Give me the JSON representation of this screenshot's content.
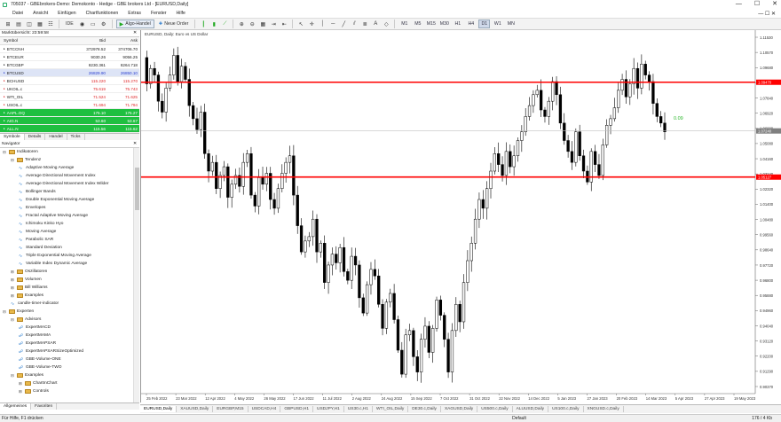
{
  "window": {
    "title": "705037 - GBEbrokers-Demo: Demokonto - Hedge - GBE brokers Ltd - [EURUSD,Daily]"
  },
  "menu": [
    "Datei",
    "Ansicht",
    "Einfügen",
    "Chartfunktionen",
    "Extras",
    "Fenster",
    "Hilfe"
  ],
  "toolbar": {
    "algo": "Algo-Handel",
    "new_order": "Neue Order",
    "ide": "IDE",
    "timeframes": [
      "M1",
      "M5",
      "M15",
      "M30",
      "H1",
      "H4",
      "D1",
      "W1",
      "MN"
    ],
    "active_tf": "D1"
  },
  "market_watch": {
    "title": "Marktübersicht: 23:59:58",
    "headers": [
      "Symbol",
      "Bid",
      "Ask"
    ],
    "rows": [
      {
        "symbol": "BTCCNH",
        "bid": "372978.52",
        "ask": "374706.70",
        "bg": "#ffffff",
        "fg": "#222222",
        "bidc": "#222222",
        "askc": "#222222"
      },
      {
        "symbol": "BTCEUR",
        "bid": "9030.26",
        "ask": "9056.25",
        "bg": "#ffffff",
        "fg": "#222222",
        "bidc": "#222222",
        "askc": "#222222"
      },
      {
        "symbol": "BTCGBP",
        "bid": "8230.361",
        "ask": "8264.718",
        "bg": "#ffffff",
        "fg": "#222222",
        "bidc": "#222222",
        "askc": "#222222"
      },
      {
        "symbol": "BTCUSD",
        "bid": "26829.90",
        "ask": "26850.10",
        "bg": "#dde4f6",
        "fg": "#222222",
        "bidc": "#2a3fd0",
        "askc": "#2a3fd0"
      },
      {
        "symbol": "BCHUSD",
        "bid": "115.220",
        "ask": "115.270",
        "bg": "#ffffff",
        "fg": "#222222",
        "bidc": "#e0282a",
        "askc": "#e0282a"
      },
      {
        "symbol": "UKOIL.c",
        "bid": "75.619",
        "ask": "75.743",
        "bg": "#ffffff",
        "fg": "#222222",
        "bidc": "#e0282a",
        "askc": "#e0282a"
      },
      {
        "symbol": "WTI_OIL",
        "bid": "71.524",
        "ask": "71.625",
        "bg": "#ffffff",
        "fg": "#222222",
        "bidc": "#e0282a",
        "askc": "#e0282a"
      },
      {
        "symbol": "USOIL.c",
        "bid": "71.694",
        "ask": "71.794",
        "bg": "#ffffff",
        "fg": "#222222",
        "bidc": "#e0282a",
        "askc": "#e0282a"
      },
      {
        "symbol": "AAPL.OQ",
        "bid": "175.10",
        "ask": "175.27",
        "bg": "#1fbf40",
        "fg": "#ffffff",
        "bidc": "#ffffff",
        "askc": "#ffffff"
      },
      {
        "symbol": "AIG.N",
        "bid": "53.60",
        "ask": "53.67",
        "bg": "#1fbf40",
        "fg": "#ffffff",
        "bidc": "#ffffff",
        "askc": "#ffffff"
      },
      {
        "symbol": "ALL.N",
        "bid": "115.56",
        "ask": "115.62",
        "bg": "#1fbf40",
        "fg": "#ffffff",
        "bidc": "#ffffff",
        "askc": "#ffffff"
      }
    ],
    "tabs": [
      "Symbole",
      "Details",
      "Handel",
      "Ticks"
    ]
  },
  "navigator": {
    "title": "Navigator",
    "items": [
      {
        "label": "Indikatoren",
        "lvl": 0,
        "type": "folder",
        "exp": "-"
      },
      {
        "label": "Tendenz",
        "lvl": 1,
        "type": "folder",
        "exp": "-"
      },
      {
        "label": "Adaptive Moving Average",
        "lvl": 2,
        "type": "ind"
      },
      {
        "label": "Average Directional Movement Index",
        "lvl": 2,
        "type": "ind"
      },
      {
        "label": "Average Directional Movement Index Wilder",
        "lvl": 2,
        "type": "ind"
      },
      {
        "label": "Bollinger Bands",
        "lvl": 2,
        "type": "ind"
      },
      {
        "label": "Double Exponential Moving Average",
        "lvl": 2,
        "type": "ind"
      },
      {
        "label": "Envelopes",
        "lvl": 2,
        "type": "ind"
      },
      {
        "label": "Fractal Adaptive Moving Average",
        "lvl": 2,
        "type": "ind"
      },
      {
        "label": "Ichimoku Kinko Hyo",
        "lvl": 2,
        "type": "ind"
      },
      {
        "label": "Moving Average",
        "lvl": 2,
        "type": "ind"
      },
      {
        "label": "Parabolic SAR",
        "lvl": 2,
        "type": "ind"
      },
      {
        "label": "Standard Deviation",
        "lvl": 2,
        "type": "ind"
      },
      {
        "label": "Triple Exponential Moving Average",
        "lvl": 2,
        "type": "ind"
      },
      {
        "label": "Variable Index Dynamic Average",
        "lvl": 2,
        "type": "ind"
      },
      {
        "label": "Oszillatoren",
        "lvl": 1,
        "type": "folder",
        "exp": "+"
      },
      {
        "label": "Volumen",
        "lvl": 1,
        "type": "folder",
        "exp": "+"
      },
      {
        "label": "Bill Williams",
        "lvl": 1,
        "type": "folder",
        "exp": "+"
      },
      {
        "label": "Examples",
        "lvl": 1,
        "type": "folder",
        "exp": "+"
      },
      {
        "label": "candle-timer-indicator",
        "lvl": 1,
        "type": "ind"
      },
      {
        "label": "Experten",
        "lvl": 0,
        "type": "folder",
        "exp": "-"
      },
      {
        "label": "Advisors",
        "lvl": 1,
        "type": "folder",
        "exp": "-"
      },
      {
        "label": "ExpertMACD",
        "lvl": 2,
        "type": "exp"
      },
      {
        "label": "ExpertMAMA",
        "lvl": 2,
        "type": "exp"
      },
      {
        "label": "ExpertMAPSAR",
        "lvl": 2,
        "type": "exp"
      },
      {
        "label": "ExpertMAPSARSizeOptimized",
        "lvl": 2,
        "type": "exp"
      },
      {
        "label": "GBE-Volume-ONE",
        "lvl": 2,
        "type": "exp"
      },
      {
        "label": "GBE-Volume-TWO",
        "lvl": 2,
        "type": "exp"
      },
      {
        "label": "Examples",
        "lvl": 1,
        "type": "folder",
        "exp": "-"
      },
      {
        "label": "ChartInChart",
        "lvl": 2,
        "type": "folder",
        "exp": "+"
      },
      {
        "label": "Controls",
        "lvl": 2,
        "type": "folder",
        "exp": "+"
      }
    ],
    "tabs": [
      "Allgemeines",
      "Favoriten"
    ]
  },
  "chart_tabs": [
    "EURUSD,Daily",
    "XAUUSD,Daily",
    "EURGBP,M15",
    "USDCAD,H4",
    "GBPUSD,H1",
    "USDJPY,H1",
    "US30.c,H1",
    "WTI_OIL,Daily",
    "DE30.c,Daily",
    "XAGUSD,Daily",
    "US500.c,Daily",
    "ALUUSD,Daily",
    "US100.c,Daily",
    "XNGUSD.c,Daily"
  ],
  "active_chart_tab": "EURUSD,Daily",
  "status": {
    "help": "Für Hilfe, F1 drücken",
    "profile": "Default",
    "traffic": "176 / 4 Kb"
  },
  "chart_data": {
    "type": "candlestick",
    "title": "EURUSD, Daily: Euro vs US Dollar",
    "ylim": [
      0.95211,
      1.1153
    ],
    "y_ticks": [
      "1.11530",
      "1.10570",
      "1.09680",
      "1.08760",
      "1.07840",
      "1.06920",
      "1.06000",
      "1.05080",
      "1.04160",
      "1.03240",
      "1.02320",
      "1.01400",
      "1.00480",
      "0.99560",
      "0.98640",
      "0.97720",
      "0.96800",
      "0.95880",
      "0.94960",
      "0.94040",
      "0.93120",
      "0.92200",
      "0.91290",
      "0.90370"
    ],
    "x_labels": [
      "25 Feb 2022",
      "23 Mar 2022",
      "12 Apr 2022",
      "4 May 2022",
      "26 May 2022",
      "17 Jun 2022",
      "11 Jul 2022",
      "2 Aug 2022",
      "24 Aug 2022",
      "15 Sep 2022",
      "7 Oct 2022",
      "31 Oct 2022",
      "22 Nov 2022",
      "14 Dec 2022",
      "5 Jan 2023",
      "27 Jan 2023",
      "20 Feb 2023",
      "14 Mar 2023",
      "5 Apr 2023",
      "27 Apr 2023",
      "19 May 2023"
    ],
    "levels": [
      {
        "value": 1.0947,
        "label": "1.09470",
        "color": "#ff0000"
      },
      {
        "value": 1.05127,
        "label": "1.05127",
        "color": "#ff0000"
      }
    ],
    "bid_line": {
      "value": 1.0724,
      "label": "1.07240",
      "color": "#c0c0c0"
    },
    "text_label": {
      "text": "0.09",
      "color": "#2eb82e"
    },
    "path": [
      1.106,
      1.094,
      1.101,
      1.098,
      1.086,
      1.081,
      1.092,
      1.098,
      1.107,
      1.095,
      1.102,
      1.096,
      1.084,
      1.078,
      1.073,
      1.081,
      1.062,
      1.054,
      1.058,
      1.046,
      1.052,
      1.056,
      1.042,
      1.048,
      1.052,
      1.047,
      1.058,
      1.062,
      1.043,
      1.038,
      1.051,
      1.048,
      1.053,
      1.041,
      1.037,
      1.046,
      1.053,
      1.058,
      1.061,
      1.043,
      1.029,
      1.017,
      1.022,
      1.024,
      1.032,
      1.017,
      1.021,
      1.003,
      1.011,
      1.016,
      1.012,
      1.019,
      1.008,
      1.004,
      1.015,
      1.011,
      0.996,
      0.989,
      1.002,
      1.009,
      1.006,
      0.993,
      0.982,
      0.994,
      0.998,
      0.986,
      0.972,
      0.961,
      0.979,
      0.981,
      0.969,
      0.962,
      0.977,
      0.983,
      0.971,
      0.982,
      0.995,
      0.988,
      0.977,
      0.962,
      0.981,
      0.993,
      0.985,
      1.003,
      1.013,
      1.021,
      1.032,
      1.041,
      1.037,
      1.046,
      1.054,
      1.062,
      1.057,
      1.052,
      1.063,
      1.056,
      1.061,
      1.068,
      1.072,
      1.079,
      1.084,
      1.089,
      1.091,
      1.082,
      1.079,
      1.086,
      1.095,
      1.089,
      1.076,
      1.068,
      1.063,
      1.058,
      1.072,
      1.061,
      1.054,
      1.049,
      1.063,
      1.057,
      1.052,
      1.066,
      1.075,
      1.078,
      1.083,
      1.091,
      1.096,
      1.088,
      1.094,
      1.101,
      1.092,
      1.103,
      1.098,
      1.095,
      1.085,
      1.079,
      1.076,
      1.072
    ]
  }
}
